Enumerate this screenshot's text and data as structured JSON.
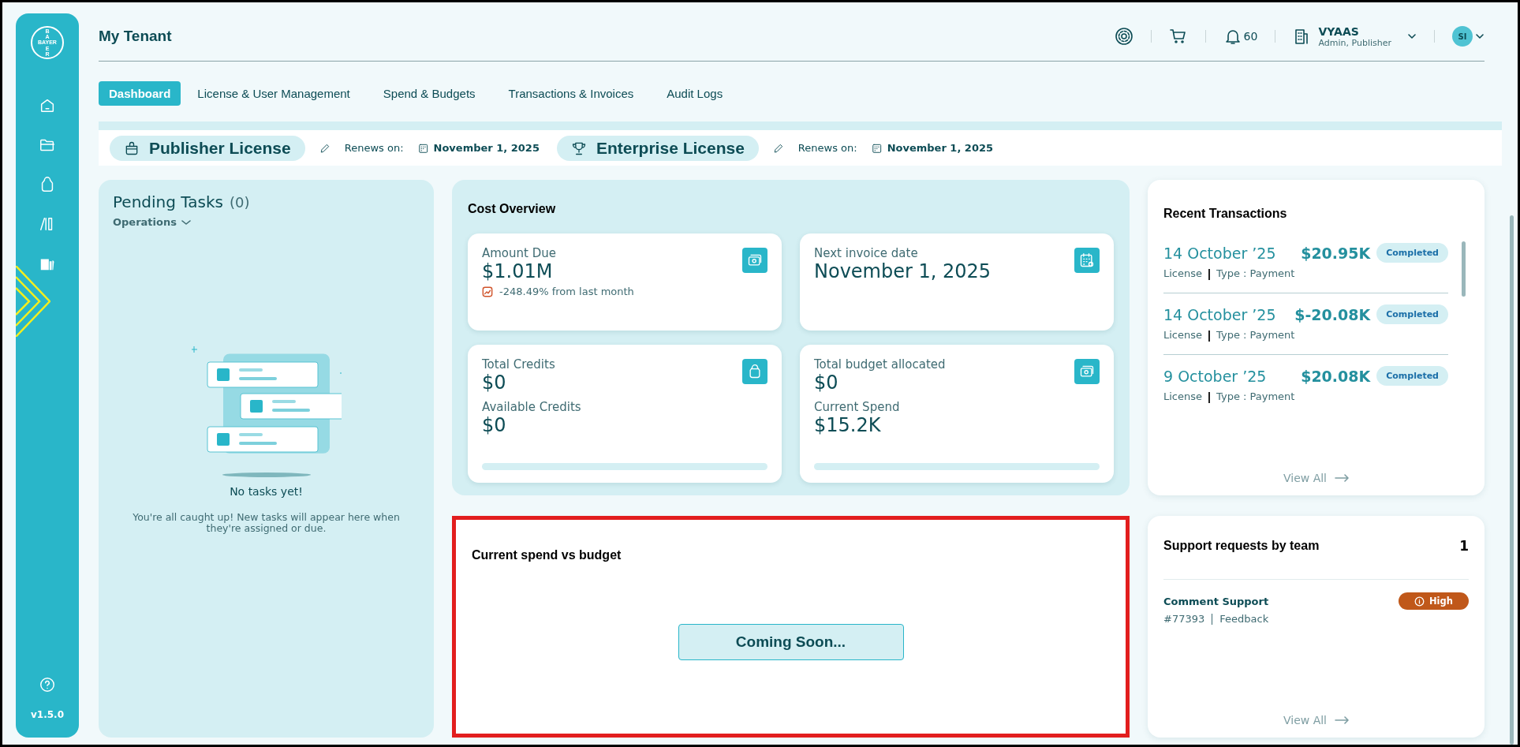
{
  "sidebar": {
    "logo": {
      "top": "BA",
      "middle": "BAYER",
      "bottom": "ER"
    },
    "version": "v1.5.0"
  },
  "header": {
    "title": "My Tenant",
    "notifications": "60",
    "org": {
      "name": "VYAAS",
      "roles": "Admin, Publisher"
    },
    "avatar": "SI"
  },
  "tabs": [
    {
      "label": "Dashboard",
      "selected": true
    },
    {
      "label": "License & User Management",
      "selected": false
    },
    {
      "label": "Spend & Budgets",
      "selected": false
    },
    {
      "label": "Transactions & Invoices",
      "selected": false
    },
    {
      "label": "Audit Logs",
      "selected": false
    }
  ],
  "licenses": [
    {
      "name": "Publisher License",
      "renews_label": "Renews on:",
      "date": "November 1, 2025"
    },
    {
      "name": "Enterprise License",
      "renews_label": "Renews on:",
      "date": "November 1, 2025"
    }
  ],
  "pending_tasks": {
    "title": "Pending Tasks",
    "count": "(0)",
    "filter": "Operations",
    "empty_title": "No tasks yet!",
    "empty_text": "You're all caught up! New tasks will appear here when they're assigned or due."
  },
  "cost_overview": {
    "title": "Cost Overview",
    "cards": [
      {
        "metrics": [
          {
            "label": "Amount Due",
            "value": "$1.01M"
          }
        ],
        "change": "-248.49% from last month"
      },
      {
        "metrics": [
          {
            "label": "Next invoice date",
            "value": "November 1, 2025"
          }
        ]
      },
      {
        "metrics": [
          {
            "label": "Total Credits",
            "value": "$0"
          },
          {
            "label": "Available Credits",
            "value": "$0"
          }
        ],
        "level": 0
      },
      {
        "metrics": [
          {
            "label": "Total budget allocated",
            "value": "$0"
          },
          {
            "label": "Current Spend",
            "value": "$15.2K"
          }
        ],
        "level": 0
      }
    ]
  },
  "spend_vs_budget": {
    "title": "Current spend vs budget",
    "highlighted": true,
    "button": "Coming Soon..."
  },
  "recent_transactions": {
    "title": "Recent Transactions",
    "rows": [
      {
        "date": "14 October ’25",
        "amount": "$20.95K",
        "category": "License",
        "type": "Type : Payment",
        "status": "Completed"
      },
      {
        "date": "14 October ’25",
        "amount": "$-20.08K",
        "category": "License",
        "type": "Type : Payment",
        "status": "Completed"
      },
      {
        "date": "9 October ’25",
        "amount": "$20.08K",
        "category": "License",
        "type": "Type : Payment",
        "status": "Completed"
      }
    ],
    "view_all": "View All"
  },
  "support": {
    "title": "Support requests by team",
    "count": "1",
    "items": [
      {
        "name": "Comment Support",
        "id": "#77393",
        "category": "Feedback",
        "priority": "High"
      }
    ],
    "view_all": "View All"
  }
}
